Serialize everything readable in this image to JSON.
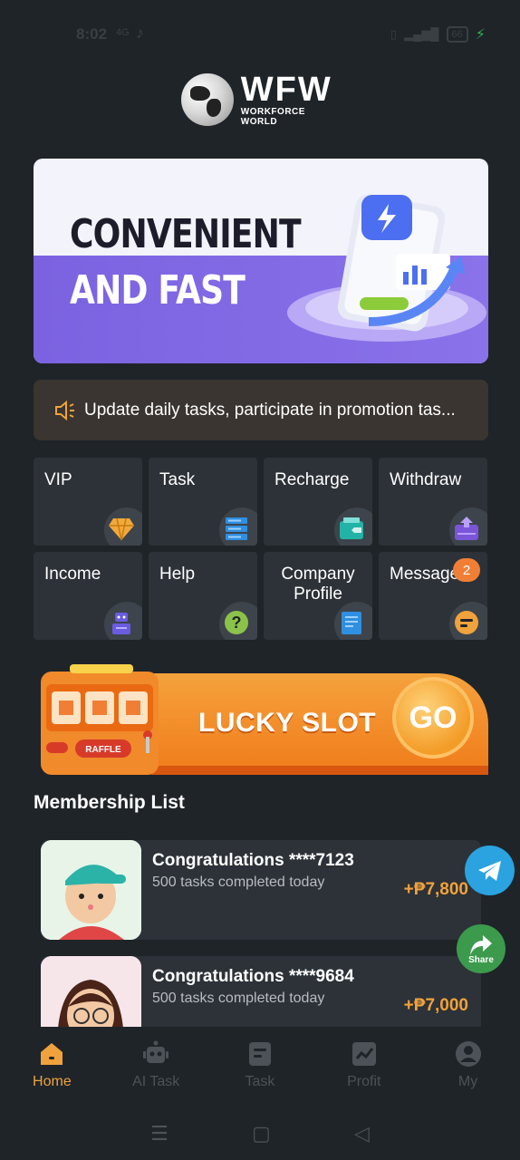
{
  "status_bar": {
    "time": "8:02",
    "tiny_label": "4G",
    "battery": "66"
  },
  "logo": {
    "main": "WFW",
    "sub": "WORKFORCE WORLD"
  },
  "banner": {
    "line1": "CONVENIENT",
    "line2": "AND FAST"
  },
  "notice": {
    "text": "Update daily tasks, participate in promotion tas..."
  },
  "grid": [
    {
      "label": "VIP",
      "icon": "diamond-icon",
      "color": "#f2a93b"
    },
    {
      "label": "Task",
      "icon": "list-icon",
      "color": "#2f8fe0"
    },
    {
      "label": "Recharge",
      "icon": "wallet-icon",
      "color": "#23b3a6"
    },
    {
      "label": "Withdraw",
      "icon": "withdraw-icon",
      "color": "#7a55d8"
    },
    {
      "label": "Income",
      "icon": "robot-icon",
      "color": "#6a5be0"
    },
    {
      "label": "Help",
      "icon": "question-icon",
      "color": "#8bc34a"
    },
    {
      "label": "Company Profile",
      "icon": "document-icon",
      "color": "#2f8fe0"
    },
    {
      "label": "Message",
      "icon": "chat-icon",
      "color": "#f0a23c",
      "badge": "2"
    }
  ],
  "slot": {
    "title": "LUCKY SLOT",
    "go": "GO",
    "raffle": "RAFFLE"
  },
  "membership": {
    "title": "Membership List",
    "items": [
      {
        "title": "Congratulations ****7123",
        "subtitle": "500 tasks completed today",
        "amount": "+₱7,800"
      },
      {
        "title": "Congratulations ****9684",
        "subtitle": "500 tasks completed today",
        "amount": "+₱7,000"
      }
    ]
  },
  "floating": {
    "share_label": "Share"
  },
  "tabs": [
    {
      "label": "Home",
      "icon": "home-icon"
    },
    {
      "label": "AI Task",
      "icon": "robot-icon"
    },
    {
      "label": "Task",
      "icon": "task-icon"
    },
    {
      "label": "Profit",
      "icon": "chart-icon"
    },
    {
      "label": "My",
      "icon": "user-icon"
    }
  ],
  "colors": {
    "background": "#1f2429",
    "tile": "#2d3238",
    "accent": "#f0a23c",
    "banner_purple": "#7b62e0"
  }
}
